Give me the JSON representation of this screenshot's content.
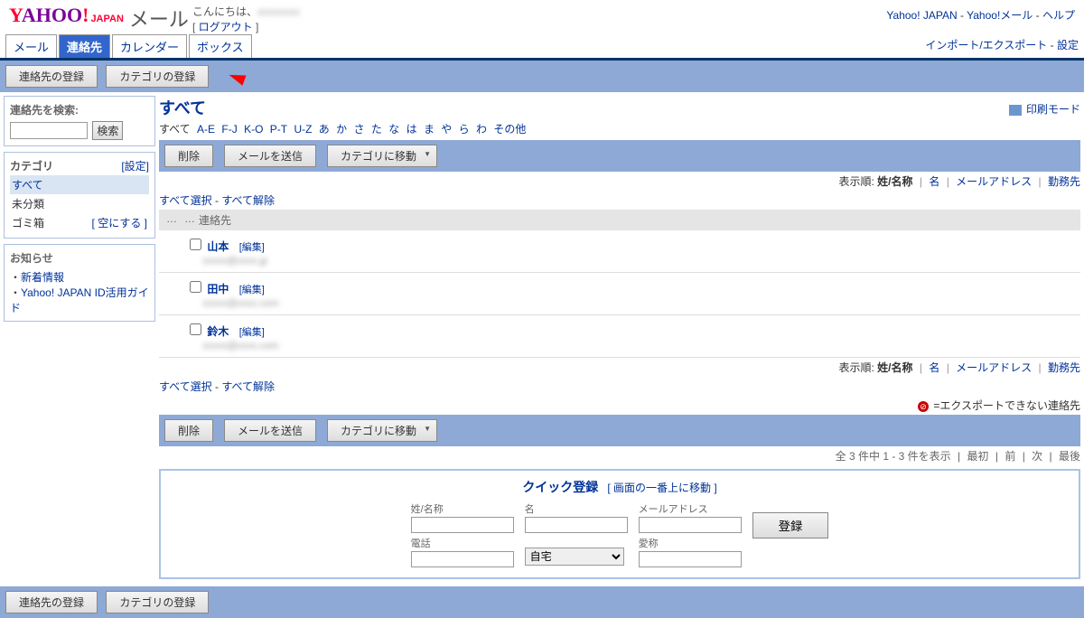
{
  "header": {
    "logo": "YAHOO!",
    "logo_sub": "JAPAN",
    "mail": "メール",
    "greeting": "こんにちは、",
    "logout": "ログアウト",
    "links": {
      "yahoo_jp": "Yahoo! JAPAN",
      "yahoo_mail": "Yahoo!メール",
      "help": "ヘルプ",
      "sep": " - "
    }
  },
  "tabs": {
    "mail": "メール",
    "contacts": "連絡先",
    "calendar": "カレンダー",
    "box": "ボックス",
    "import_export": "インポート/エクスポート",
    "settings": "設定",
    "sep": " - "
  },
  "toolbar_top": {
    "register_contact": "連絡先の登録",
    "register_category": "カテゴリの登録"
  },
  "sidebar": {
    "search": {
      "label": "連絡先を検索:",
      "button": "検索"
    },
    "categories": {
      "title": "カテゴリ",
      "settings": "[設定]",
      "items": [
        {
          "label": "すべて",
          "selected": true
        },
        {
          "label": "未分類"
        },
        {
          "label": "ゴミ箱",
          "action": "[ 空にする ]"
        }
      ]
    },
    "news": {
      "title": "お知らせ",
      "items": [
        {
          "label": "新着情報"
        },
        {
          "label": "Yahoo! JAPAN ID活用ガイド"
        }
      ]
    }
  },
  "main": {
    "title": "すべて",
    "print_mode": "印刷モード",
    "filters": {
      "all": "すべて",
      "links": [
        "A-E",
        "F-J",
        "K-O",
        "P-T",
        "U-Z",
        "あ",
        "か",
        "さ",
        "た",
        "な",
        "は",
        "ま",
        "や",
        "ら",
        "わ",
        "その他"
      ]
    },
    "actions": {
      "delete": "削除",
      "send_mail": "メールを送信",
      "move_category": "カテゴリに移動"
    },
    "sort": {
      "label": "表示順:",
      "name": "姓/名称",
      "first": "名",
      "email": "メールアドレス",
      "work": "勤務先"
    },
    "select": {
      "all": "すべて選択",
      "none": "すべて解除",
      "sep": " - "
    },
    "table": {
      "header": "連絡先",
      "dots": "…",
      "rows": [
        {
          "name": "山本",
          "edit": "[編集]",
          "email": "xxxxx@xxxx.jp"
        },
        {
          "name": "田中",
          "edit": "[編集]",
          "email": "xxxxx@xxxx.com"
        },
        {
          "name": "鈴木",
          "edit": "[編集]",
          "email": "xxxxx@xxxx.com"
        }
      ]
    },
    "export_note": "=エクスポートできない連絡先",
    "pagination": {
      "text": "全 3 件中 1 - 3 件を表示",
      "first": "最初",
      "prev": "前",
      "next": "次",
      "last": "最後"
    },
    "quick": {
      "title": "クイック登録",
      "link": "[ 画面の一番上に移動 ]",
      "fields": {
        "name": "姓/名称",
        "first": "名",
        "email": "メールアドレス",
        "phone": "電話",
        "type_selected": "自宅",
        "nickname": "愛称"
      },
      "register": "登録"
    }
  }
}
